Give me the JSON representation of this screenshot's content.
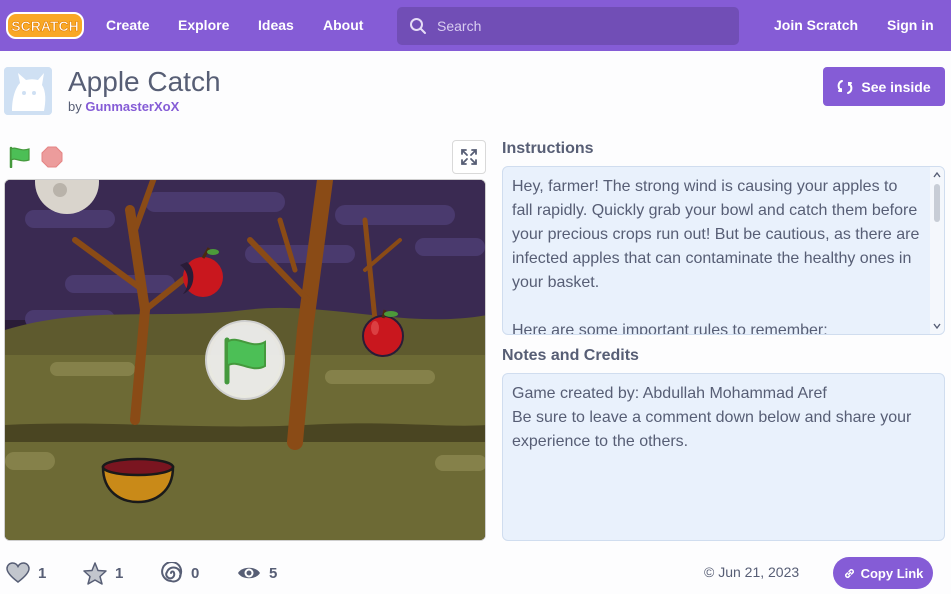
{
  "nav": {
    "logo_text": "SCRATCH",
    "items": [
      {
        "label": "Create"
      },
      {
        "label": "Explore"
      },
      {
        "label": "Ideas"
      },
      {
        "label": "About"
      }
    ],
    "search_placeholder": "Search",
    "join_label": "Join Scratch",
    "signin_label": "Sign in"
  },
  "project": {
    "title": "Apple Catch",
    "by_prefix": "by",
    "author": "GunmasterXoX",
    "see_inside_label": "See inside"
  },
  "instructions": {
    "heading": "Instructions",
    "paragraphs": [
      "Hey, farmer! The strong wind is causing your apples to fall rapidly. Quickly grab your bowl and catch them before your precious crops run out! But be cautious, as there are infected apples that can contaminate the healthy ones in your basket.",
      "Here are some important rules to remember:"
    ]
  },
  "notes": {
    "heading": "Notes and Credits",
    "lines": [
      "Game created by: Abdullah Mohammad Aref",
      "Be sure to leave a comment down below and share your experience to the others."
    ]
  },
  "stats": {
    "loves": "1",
    "favorites": "1",
    "remixes": "0",
    "views": "5"
  },
  "date": "© Jun 21, 2023",
  "copy_link_label": "Copy Link",
  "icons": {
    "flag": "green-flag-icon",
    "stop": "stop-icon",
    "fullscreen": "fullscreen-icon",
    "search": "search-icon",
    "see_inside": "remix-arrows-icon",
    "love": "heart-icon",
    "favorite": "star-icon",
    "remix": "remix-swirl-icon",
    "views": "eye-icon",
    "link": "link-icon"
  },
  "colors": {
    "brand": "#855cd6",
    "search_bg": "#714eb6",
    "box_bg": "#e9f1fc",
    "text": "#575e75"
  }
}
